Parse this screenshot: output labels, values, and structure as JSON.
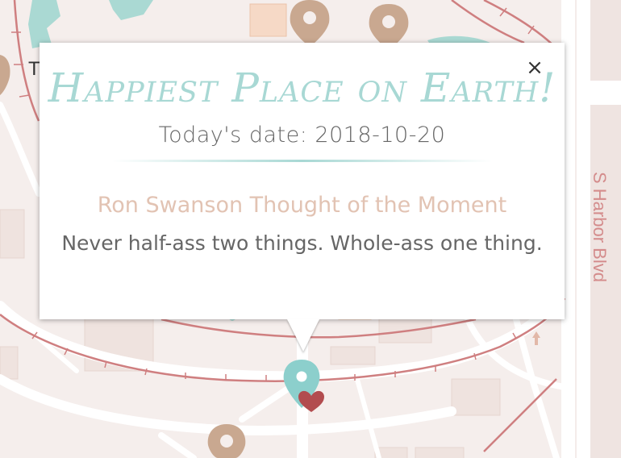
{
  "popup": {
    "title": "Happiest Place on Earth!",
    "date_label": "Today's date:",
    "date_value": "2018-10-20",
    "date_line": "Today's date: 2018-10-20",
    "quote_heading": "Ron Swanson Thought of the Moment",
    "quote_text": "Never half-ass two things. Whole-ass one thing.",
    "close_label": "×"
  },
  "map": {
    "street_label": "S Harbor Blvd",
    "partial_label": "T",
    "colors": {
      "background": "#f5eeec",
      "roads": "#ffffff",
      "railway": "#cf7f80",
      "water": "#aad9d3",
      "buildings": "#f2d9cb",
      "poi_pin": "#c9a890",
      "selected_pin": "#8ccfcc",
      "heart": "#b24c4f"
    },
    "markers": [
      {
        "name": "poi-marker",
        "icon": "map-pin-icon"
      },
      {
        "name": "selected-marker",
        "icon": "heart-icon"
      }
    ]
  }
}
